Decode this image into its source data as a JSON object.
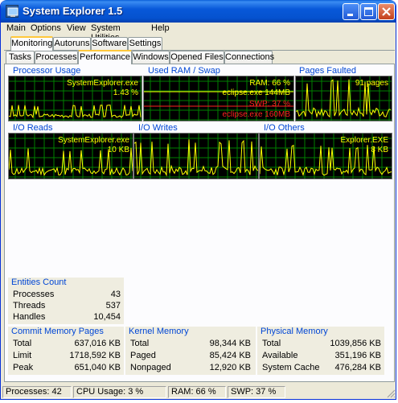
{
  "window": {
    "title": "System Explorer 1.5",
    "icon": "app-icon"
  },
  "menu": {
    "items": [
      "Main",
      "Options",
      "View",
      "System Utilities",
      "Help"
    ]
  },
  "top_tabs": [
    "Monitoring",
    "Autoruns",
    "Software",
    "Settings"
  ],
  "sub_tabs": [
    "Tasks",
    "Processes",
    "Performance",
    "Windows",
    "Opened Files",
    "Connections"
  ],
  "graphs": {
    "processor": {
      "label": "Processor Usage",
      "line1": "SystemExplorer.exe",
      "line2": "1.43 %"
    },
    "ram": {
      "label": "Used RAM / Swap",
      "line1": "RAM: 66 %",
      "line2": "eclipse.exe 144MB",
      "line3": "SWP: 37 %",
      "line4": "eclipse.exe 160MB"
    },
    "pages": {
      "label": "Pages Faulted",
      "line1": "91 pages"
    },
    "io_reads": {
      "label": "I/O Reads",
      "line1": "SystemExplorer.exe",
      "line2": "10 KB"
    },
    "io_writes": {
      "label": "I/O Writes"
    },
    "io_others": {
      "label": "I/O Others",
      "line1": "Explorer.EXE",
      "line2": "8 KB"
    }
  },
  "entities": {
    "title": "Entities Count",
    "rows": [
      {
        "label": "Processes",
        "value": "43"
      },
      {
        "label": "Threads",
        "value": "537"
      },
      {
        "label": "Handles",
        "value": "10,454"
      }
    ]
  },
  "commit": {
    "title": "Commit Memory Pages",
    "rows": [
      {
        "label": "Total",
        "value": "637,016 KB"
      },
      {
        "label": "Limit",
        "value": "1718,592 KB"
      },
      {
        "label": "Peak",
        "value": "651,040 KB"
      }
    ]
  },
  "kernel": {
    "title": "Kernel Memory",
    "rows": [
      {
        "label": "Total",
        "value": "98,344 KB"
      },
      {
        "label": "Paged",
        "value": "85,424 KB"
      },
      {
        "label": "Nonpaged",
        "value": "12,920 KB"
      }
    ]
  },
  "physical": {
    "title": "Physical Memory",
    "rows": [
      {
        "label": "Total",
        "value": "1039,856 KB"
      },
      {
        "label": "Available",
        "value": "351,196 KB"
      },
      {
        "label": "System Cache",
        "value": "476,284 KB"
      }
    ]
  },
  "status": {
    "processes": "Processes: 42",
    "cpu": "CPU Usage: 3 %",
    "ram": "RAM: 66 %",
    "swp": "SWP: 37 %"
  },
  "colors": {
    "graph_bg": "#000000",
    "grid": "#008000",
    "trace": "#ffff00",
    "swap": "#ff2020",
    "label": "#0046d5"
  }
}
